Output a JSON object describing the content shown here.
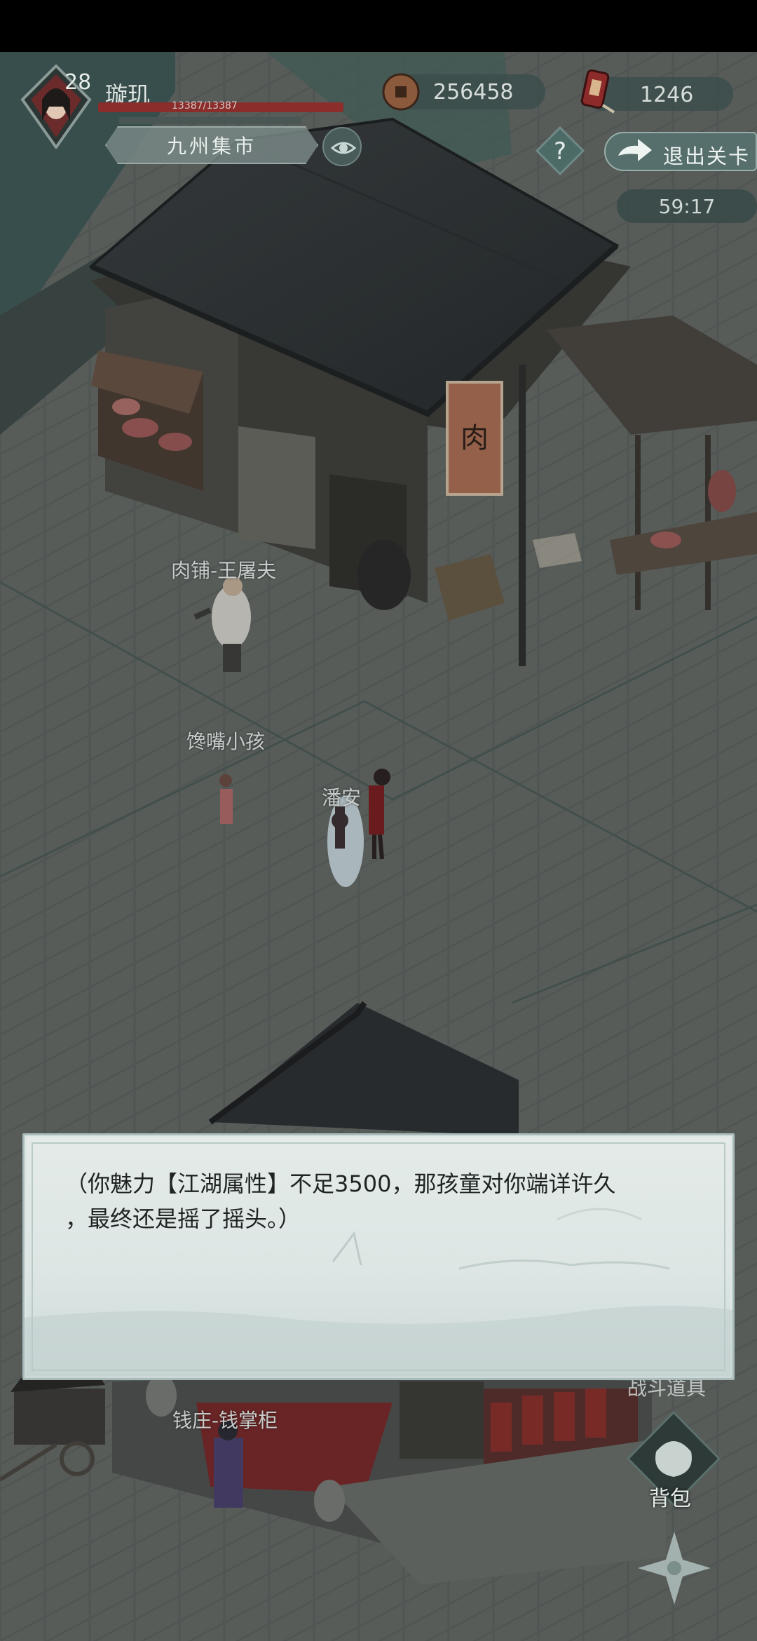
{
  "player": {
    "level": "28",
    "name": "璇玑",
    "hp_text": "13387/13387",
    "hp_fraction": 1.0
  },
  "location": {
    "name": "九州集市"
  },
  "currency": {
    "coins": "256458",
    "tokens": "1246"
  },
  "buttons": {
    "exit_label": "退出关卡",
    "help_label": "?",
    "bag_label": "背包",
    "obscured_label": "战斗道具"
  },
  "timer": "59:17",
  "npcs": [
    {
      "id": "butcher",
      "label": "肉铺-王屠夫"
    },
    {
      "id": "child",
      "label": "馋嘴小孩"
    },
    {
      "id": "panan",
      "label": "潘安"
    },
    {
      "id": "banker",
      "label": "钱庄-钱掌柜"
    }
  ],
  "shop_sign": "肉",
  "dialog": {
    "text_line1": "（你魅力【江湖属性】不足3500，那孩童对你端详许久",
    "text_line2": "，最终还是摇了摇头。）"
  },
  "colors": {
    "ground": "#5d625f",
    "roof": "#2f3336",
    "hp": "#8a2d2b",
    "dialog_bg": "#e2e9e7",
    "accent_teal": "#5b7c78"
  }
}
